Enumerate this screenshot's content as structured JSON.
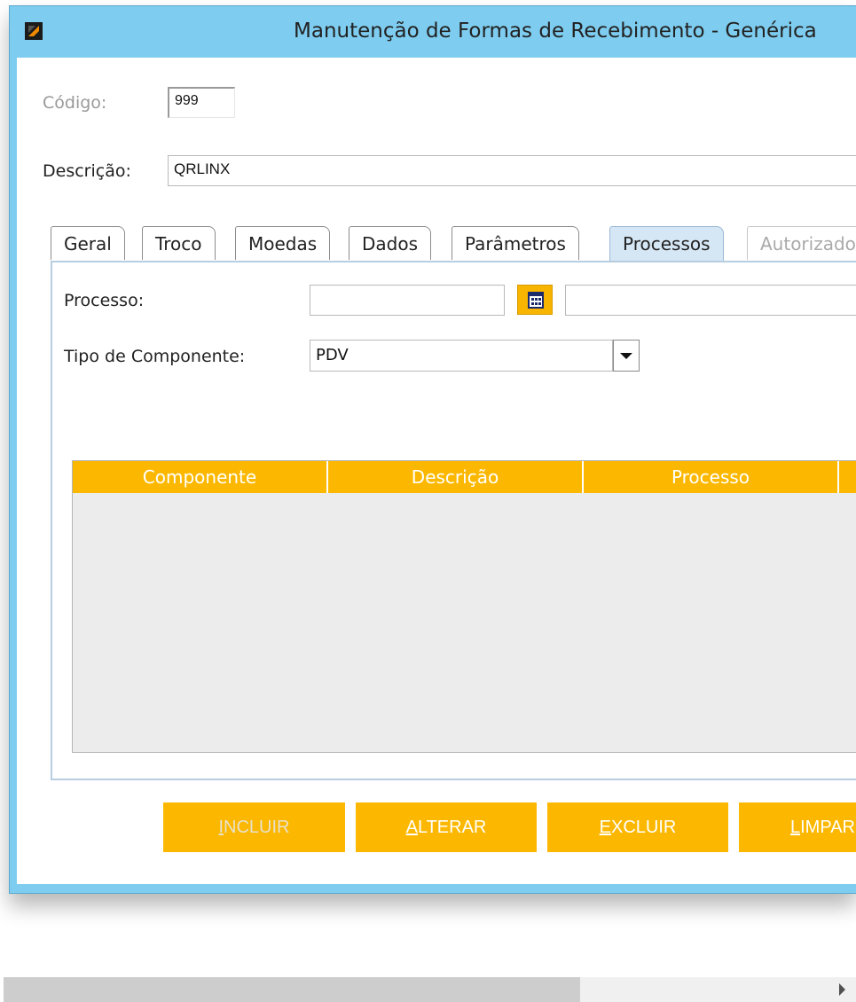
{
  "window": {
    "title": "Manutenção de Formas de Recebimento - Genérica"
  },
  "form": {
    "codigo_label": "Código:",
    "codigo_value": "999",
    "descricao_label": "Descrição:",
    "descricao_value": "QRLINX"
  },
  "tabs": [
    {
      "label": "Geral"
    },
    {
      "label": "Troco"
    },
    {
      "label": "Moedas"
    },
    {
      "label": "Dados"
    },
    {
      "label": "Parâmetros"
    },
    {
      "label": "Processos"
    },
    {
      "label": "Autorizado"
    }
  ],
  "processos": {
    "processo_label": "Processo:",
    "processo_value": "",
    "processo_desc_value": "",
    "tipo_label": "Tipo de Componente:",
    "tipo_value": "PDV"
  },
  "grid": {
    "columns": [
      "Componente",
      "Descrição",
      "Processo"
    ]
  },
  "buttons": {
    "incluir": {
      "mnemonic": "I",
      "rest": "NCLUIR"
    },
    "alterar": {
      "mnemonic": "A",
      "rest": "LTERAR"
    },
    "excluir": {
      "mnemonic": "E",
      "rest": "XCLUIR"
    },
    "limpar": {
      "mnemonic": "L",
      "rest": "IMPAR"
    }
  },
  "colors": {
    "accent": "#fcb800",
    "titlebar": "#7ecdf0",
    "active_tab": "#d5e6f5"
  }
}
